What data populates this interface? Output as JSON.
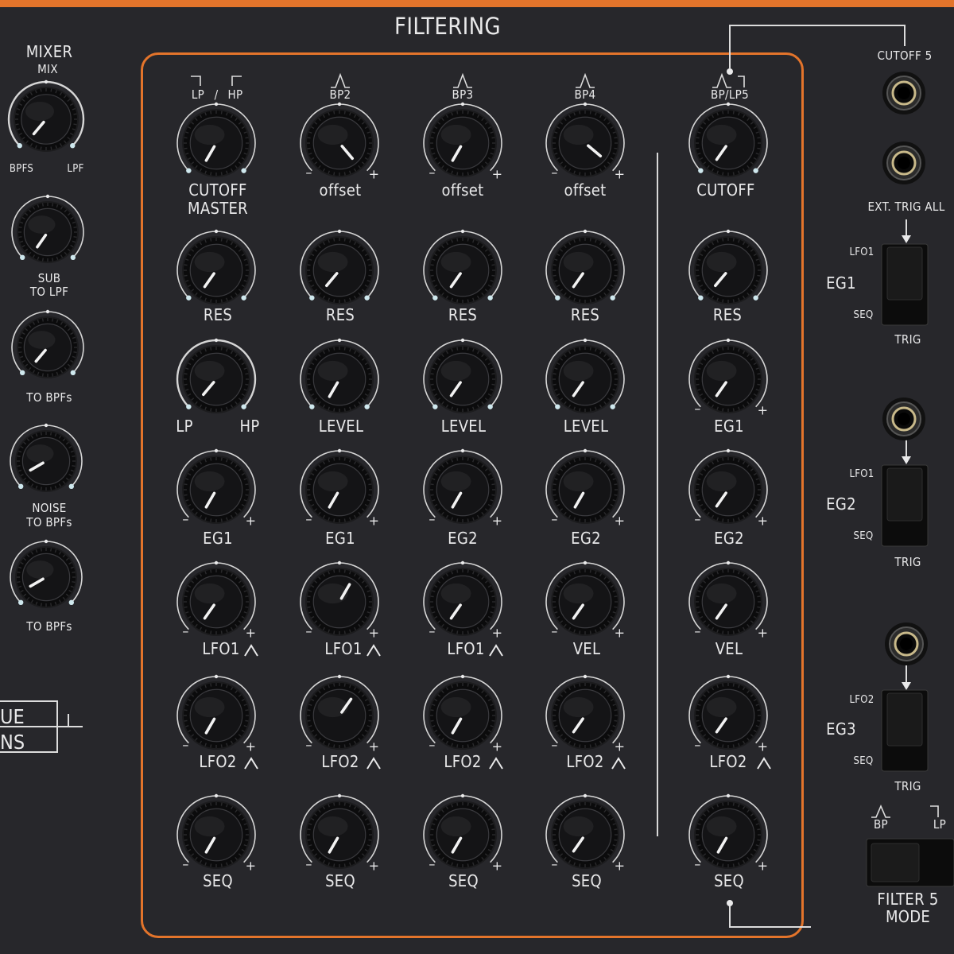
{
  "panel": {
    "accent_color": "#e3742b",
    "background_color": "#27272b",
    "title": "FILTERING",
    "mixer": {
      "header_1": "MIXER",
      "header_2": "MIX",
      "mix_left": "BPFS",
      "mix_right": "LPF",
      "knob_2_label_1": "SUB",
      "knob_2_label_2": "TO LPF",
      "knob_3_label": "TO BPFs",
      "knob_4_label_1": "NOISE",
      "knob_4_label_2": "TO BPFs",
      "knob_5_label": "TO BPFs",
      "box_line_1": "UE",
      "box_line_2": "NS"
    },
    "columns": [
      {
        "header_left": "LP",
        "header_sep": "/",
        "header_right": "HP",
        "top_1": "CUTOFF",
        "top_2": "MASTER",
        "res": "RES",
        "mode_left": "LP",
        "mode_right": "HP",
        "row4": "EG1",
        "row5": "LFO1",
        "row6": "LFO2",
        "row7": "SEQ"
      },
      {
        "header": "BP2",
        "top_1": "offset",
        "res": "RES",
        "row3": "LEVEL",
        "row4": "EG1",
        "row5": "LFO1",
        "row6": "LFO2",
        "row7": "SEQ"
      },
      {
        "header": "BP3",
        "top_1": "offset",
        "res": "RES",
        "row3": "LEVEL",
        "row4": "EG2",
        "row5": "LFO1",
        "row6": "LFO2",
        "row7": "SEQ"
      },
      {
        "header": "BP4",
        "top_1": "offset",
        "res": "RES",
        "row3": "LEVEL",
        "row4": "EG2",
        "row5": "VEL",
        "row6": "LFO2",
        "row7": "SEQ"
      },
      {
        "header": "BP/LP5",
        "top_1": "CUTOFF",
        "res": "RES",
        "row3": "EG1",
        "row4": "EG2",
        "row5": "VEL",
        "row6": "LFO2",
        "row7": "SEQ"
      }
    ],
    "right": {
      "cutoff_jack": "CUTOFF 5",
      "ext_trig": "EXT. TRIG ALL",
      "eg1": {
        "name": "EG1",
        "top": "LFO1",
        "bottom": "SEQ",
        "trig": "TRIG"
      },
      "eg2": {
        "name": "EG2",
        "top": "LFO1",
        "bottom": "SEQ",
        "trig": "TRIG"
      },
      "eg3": {
        "name": "EG3",
        "top": "LFO2",
        "bottom": "SEQ",
        "trig": "TRIG"
      },
      "mode_bp": "BP",
      "mode_lp": "LP",
      "filter_mode_1": "FILTER 5",
      "filter_mode_2": "MODE"
    }
  }
}
